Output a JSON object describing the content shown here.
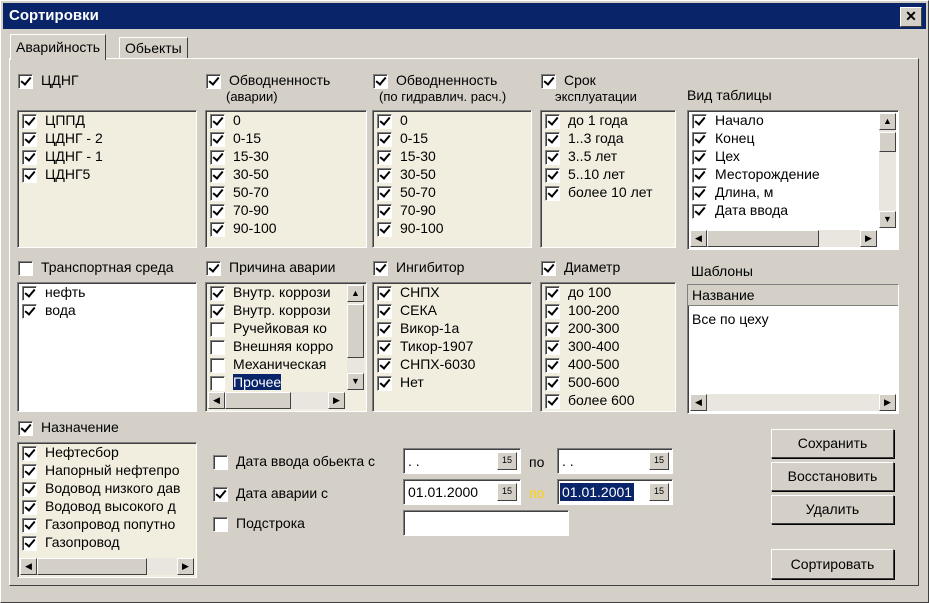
{
  "window": {
    "title": "Сортировки",
    "close_glyph": "✕"
  },
  "tabs": [
    {
      "label": "Аварийность"
    },
    {
      "label": "Обьекты"
    }
  ],
  "groups": {
    "cdng": {
      "label": "ЦДНГ",
      "checked": true,
      "items": [
        {
          "label": "ЦППД",
          "checked": true
        },
        {
          "label": "ЦДНГ - 2",
          "checked": true
        },
        {
          "label": "ЦДНГ - 1",
          "checked": true
        },
        {
          "label": "ЦДНГ5",
          "checked": true
        }
      ]
    },
    "water1": {
      "label": "Обводненность",
      "sub": "(аварии)",
      "checked": true,
      "items": [
        {
          "label": "0",
          "checked": true
        },
        {
          "label": "0-15",
          "checked": true
        },
        {
          "label": "15-30",
          "checked": true
        },
        {
          "label": "30-50",
          "checked": true
        },
        {
          "label": "50-70",
          "checked": true
        },
        {
          "label": "70-90",
          "checked": true
        },
        {
          "label": "90-100",
          "checked": true
        }
      ]
    },
    "water2": {
      "label": "Обводненность",
      "sub": "(по гидравлич. расч.)",
      "checked": true,
      "items": [
        {
          "label": "0",
          "checked": true
        },
        {
          "label": "0-15",
          "checked": true
        },
        {
          "label": "15-30",
          "checked": true
        },
        {
          "label": "30-50",
          "checked": true
        },
        {
          "label": "50-70",
          "checked": true
        },
        {
          "label": "70-90",
          "checked": true
        },
        {
          "label": "90-100",
          "checked": true
        }
      ]
    },
    "term": {
      "label": "Срок",
      "sub": "эксплуатации",
      "checked": true,
      "items": [
        {
          "label": "до 1 года",
          "checked": true
        },
        {
          "label": "1..3 года",
          "checked": true
        },
        {
          "label": "3..5 лет",
          "checked": true
        },
        {
          "label": "5..10 лет",
          "checked": true
        },
        {
          "label": "более 10 лет",
          "checked": true
        }
      ]
    },
    "table_view": {
      "label": "Вид таблицы",
      "items": [
        {
          "label": "Начало",
          "checked": true
        },
        {
          "label": "Конец",
          "checked": true
        },
        {
          "label": "Цех",
          "checked": true
        },
        {
          "label": "Месторождение",
          "checked": true
        },
        {
          "label": "Длина, м",
          "checked": true
        },
        {
          "label": "Дата ввода",
          "checked": true
        }
      ]
    },
    "medium": {
      "label": "Транспортная среда",
      "checked": false,
      "items": [
        {
          "label": "нефть",
          "checked": true
        },
        {
          "label": "вода",
          "checked": true
        }
      ]
    },
    "cause": {
      "label": "Причина аварии",
      "checked": true,
      "items": [
        {
          "label": "Внутр. коррози",
          "checked": true
        },
        {
          "label": "Внутр. коррози",
          "checked": true
        },
        {
          "label": "Ручейковая ко",
          "checked": false
        },
        {
          "label": "Внешняя корро",
          "checked": false
        },
        {
          "label": "Механическая",
          "checked": false
        },
        {
          "label": "Прочее",
          "checked": false
        }
      ]
    },
    "inhibitor": {
      "label": "Ингибитор",
      "checked": true,
      "items": [
        {
          "label": "СНПХ",
          "checked": true
        },
        {
          "label": "СЕКА",
          "checked": true
        },
        {
          "label": "Викор-1а",
          "checked": true
        },
        {
          "label": "Тикор-1907",
          "checked": true
        },
        {
          "label": "СНПХ-6030",
          "checked": true
        },
        {
          "label": "Нет",
          "checked": true
        }
      ]
    },
    "diameter": {
      "label": "Диаметр",
      "checked": true,
      "items": [
        {
          "label": "до 100",
          "checked": true
        },
        {
          "label": "100-200",
          "checked": true
        },
        {
          "label": "200-300",
          "checked": true
        },
        {
          "label": "300-400",
          "checked": true
        },
        {
          "label": "400-500",
          "checked": true
        },
        {
          "label": "500-600",
          "checked": true
        },
        {
          "label": "более 600",
          "checked": true
        }
      ]
    },
    "templates": {
      "label": "Шаблоны",
      "column": "Название",
      "rows": [
        "Все по цеху"
      ]
    },
    "purpose": {
      "label": "Назначение",
      "checked": true,
      "items": [
        {
          "label": "Нефтесбор",
          "checked": true
        },
        {
          "label": "Напорный нефтепро",
          "checked": true
        },
        {
          "label": "Водовод низкого дав",
          "checked": true
        },
        {
          "label": "Водовод высокого д",
          "checked": true
        },
        {
          "label": "Газопровод попутно",
          "checked": true
        },
        {
          "label": "Газопровод",
          "checked": true
        }
      ]
    }
  },
  "dates": {
    "commission": {
      "label": "Дата ввода обьекта с",
      "checked": false,
      "from": " . .",
      "to_label": "по",
      "to": " . ."
    },
    "accident": {
      "label": "Дата аварии с",
      "checked": true,
      "from": "01.01.2000",
      "to_label": "по",
      "to": "01.01.2001"
    },
    "substring": {
      "label": "Подстрока",
      "checked": false,
      "value": ""
    },
    "cal_glyph": "15"
  },
  "buttons": {
    "save": "Сохранить",
    "restore": "Восстановить",
    "delete": "Удалить",
    "sort": "Сортировать"
  },
  "colors": {
    "title_bg": "#0a246a",
    "list_bg": "#f1eee0",
    "face": "#d4d0c8",
    "to_label_highlight": "#ffd200"
  }
}
